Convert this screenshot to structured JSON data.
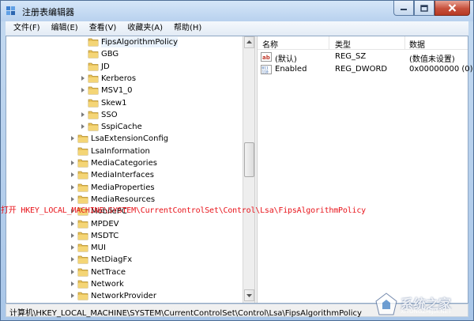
{
  "window": {
    "title": "注册表编辑器"
  },
  "menu": [
    {
      "label": "文件(F)"
    },
    {
      "label": "编辑(E)"
    },
    {
      "label": "查看(V)"
    },
    {
      "label": "收藏夹(A)"
    },
    {
      "label": "帮助(H)"
    }
  ],
  "tree": [
    {
      "label": "FipsAlgorithmPolicy",
      "level": 2,
      "expandable": false,
      "selected": true
    },
    {
      "label": "GBG",
      "level": 2,
      "expandable": false
    },
    {
      "label": "JD",
      "level": 2,
      "expandable": false
    },
    {
      "label": "Kerberos",
      "level": 2,
      "expandable": true
    },
    {
      "label": "MSV1_0",
      "level": 2,
      "expandable": true
    },
    {
      "label": "Skew1",
      "level": 2,
      "expandable": false
    },
    {
      "label": "SSO",
      "level": 2,
      "expandable": true
    },
    {
      "label": "SspiCache",
      "level": 2,
      "expandable": true
    },
    {
      "label": "LsaExtensionConfig",
      "level": 1,
      "expandable": true
    },
    {
      "label": "LsaInformation",
      "level": 1,
      "expandable": false
    },
    {
      "label": "MediaCategories",
      "level": 1,
      "expandable": true
    },
    {
      "label": "MediaInterfaces",
      "level": 1,
      "expandable": true
    },
    {
      "label": "MediaProperties",
      "level": 1,
      "expandable": true
    },
    {
      "label": "MediaResources",
      "level": 1,
      "expandable": true
    },
    {
      "label": "MobilePC",
      "level": 1,
      "expandable": true
    },
    {
      "label": "MPDEV",
      "level": 1,
      "expandable": true
    },
    {
      "label": "MSDTC",
      "level": 1,
      "expandable": true
    },
    {
      "label": "MUI",
      "level": 1,
      "expandable": true
    },
    {
      "label": "NetDiagFx",
      "level": 1,
      "expandable": true
    },
    {
      "label": "NetTrace",
      "level": 1,
      "expandable": true
    },
    {
      "label": "Network",
      "level": 1,
      "expandable": true
    },
    {
      "label": "NetworkProvider",
      "level": 1,
      "expandable": true
    }
  ],
  "list": {
    "headers": {
      "name": "名称",
      "type": "类型",
      "data": "数据"
    },
    "rows": [
      {
        "icon": "string-value-icon",
        "name": "(默认)",
        "type": "REG_SZ",
        "data": "(数值未设置)"
      },
      {
        "icon": "dword-value-icon",
        "name": "Enabled",
        "type": "REG_DWORD",
        "data": "0x00000000 (0)"
      }
    ]
  },
  "annotation": "打开 HKEY_LOCAL_MACHINE\\SYSTEM\\CurrentControlSet\\Control\\Lsa\\FipsAlgorithmPolicy",
  "status": {
    "path": "计算机\\HKEY_LOCAL_MACHINE\\SYSTEM\\CurrentControlSet\\Control\\Lsa\\FipsAlgorithmPolicy"
  },
  "watermark": {
    "text": "系统之家",
    "sub": "XITONGZHIJIA.NET"
  },
  "colors": {
    "accent": "#4a86c7",
    "annotation": "#e8141b",
    "close": "#c7503b",
    "folder": "#e8c25a"
  }
}
